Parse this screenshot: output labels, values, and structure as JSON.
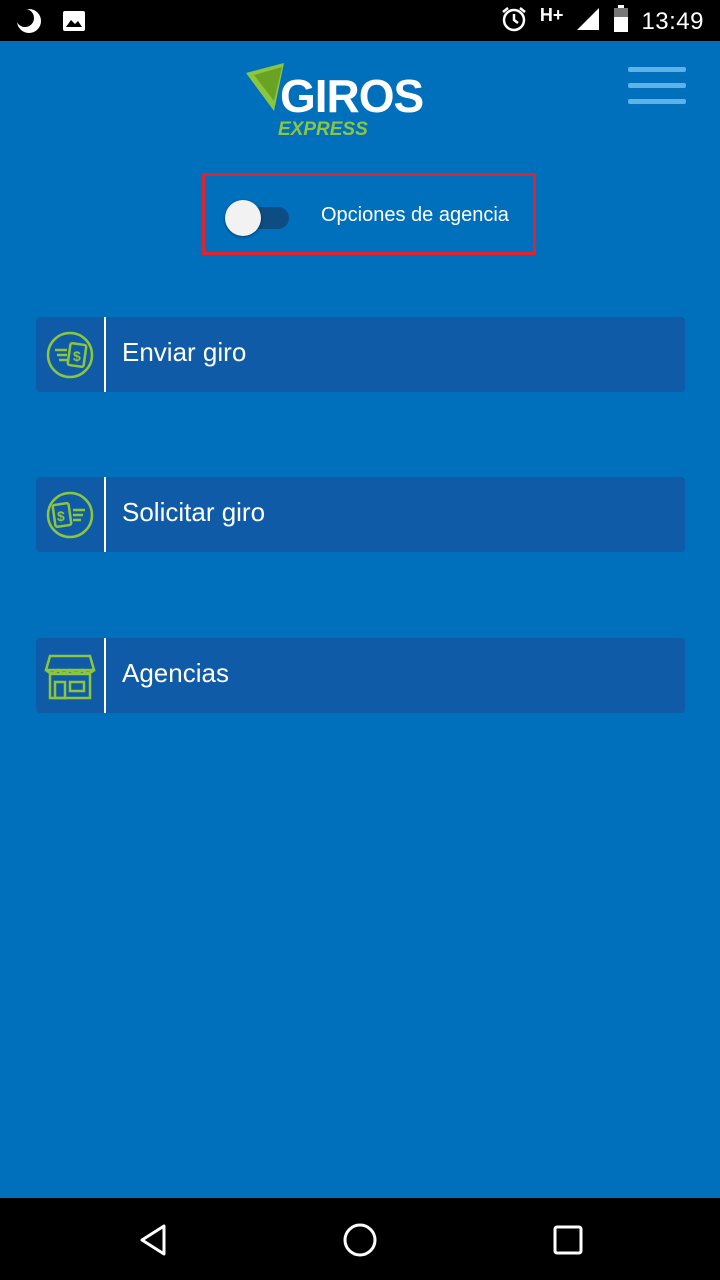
{
  "status_bar": {
    "time": "13:49",
    "network": "H+",
    "icons": [
      "moon-icon",
      "image-icon",
      "alarm-icon",
      "signal-icon",
      "battery-icon"
    ]
  },
  "header": {
    "logo_main": "GIROS",
    "logo_sub": "EXPRESS",
    "menu_icon": "hamburger-icon"
  },
  "agency_toggle": {
    "label": "Opciones de agencia",
    "enabled": false
  },
  "menu": {
    "items": [
      {
        "label": "Enviar giro",
        "icon": "send-money-icon"
      },
      {
        "label": "Solicitar giro",
        "icon": "request-money-icon"
      },
      {
        "label": "Agencias",
        "icon": "store-icon"
      }
    ]
  },
  "nav_bar": {
    "buttons": [
      "back-icon",
      "home-icon",
      "recents-icon"
    ]
  },
  "colors": {
    "background": "#0070bd",
    "item_background": "#0f5ba8",
    "accent_green": "#8cc63f",
    "highlight_red": "#e0232e"
  }
}
